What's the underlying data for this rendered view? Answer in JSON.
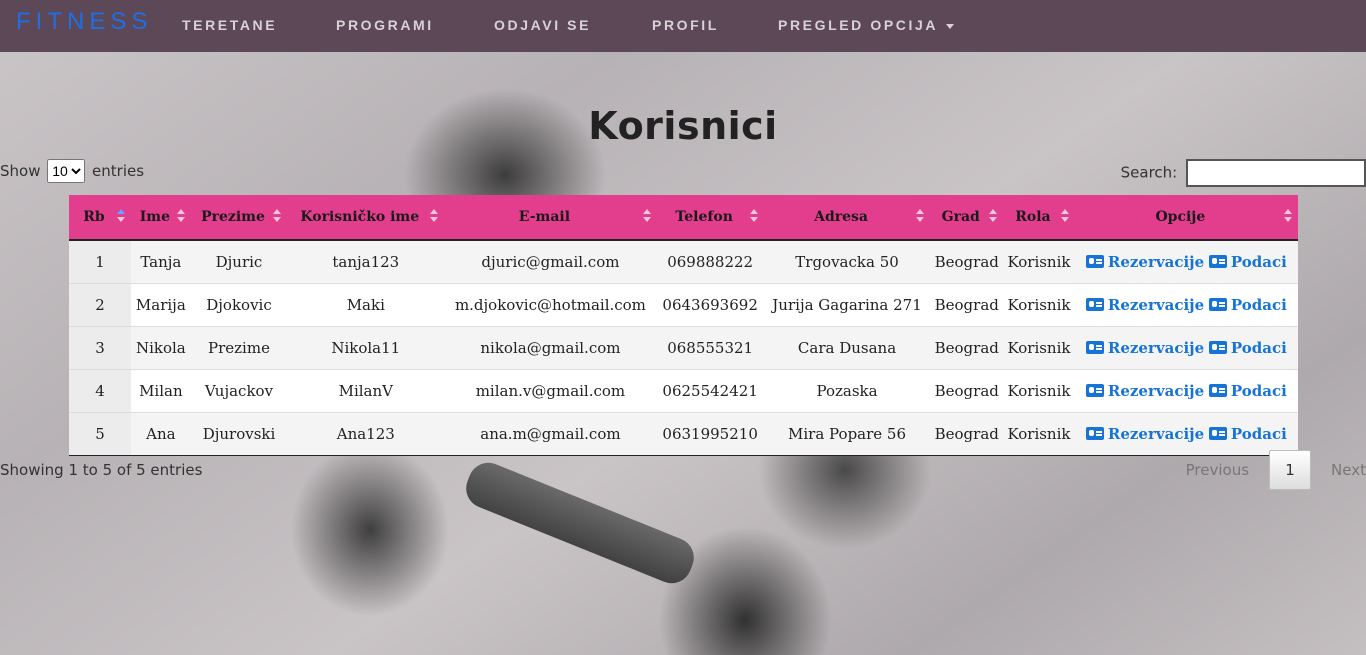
{
  "nav": {
    "brand": "FITNESS",
    "links": [
      "TERETANE",
      "PROGRAMI",
      "ODJAVI SE",
      "PROFIL",
      "PREGLED OPCIJA"
    ]
  },
  "page": {
    "title": "Korisnici"
  },
  "controls": {
    "show_label": "Show",
    "entries_label": "entries",
    "length_value": "10",
    "search_label": "Search:",
    "search_value": ""
  },
  "table": {
    "columns": [
      "Rb",
      "Ime",
      "Prezime",
      "Korisničko ime",
      "E-mail",
      "Telefon",
      "Adresa",
      "Grad",
      "Rola",
      "Opcije"
    ],
    "rows": [
      {
        "rb": "1",
        "ime": "Tanja",
        "prezime": "Djuric",
        "korisnicko": "tanja123",
        "email": "djuric@gmail.com",
        "telefon": "069888222",
        "adresa": "Trgovacka 50",
        "grad": "Beograd",
        "rola": "Korisnik"
      },
      {
        "rb": "2",
        "ime": "Marija",
        "prezime": "Djokovic",
        "korisnicko": "Maki",
        "email": "m.djokovic@hotmail.com",
        "telefon": "0643693692",
        "adresa": "Jurija Gagarina 271",
        "grad": "Beograd",
        "rola": "Korisnik"
      },
      {
        "rb": "3",
        "ime": "Nikola",
        "prezime": "Prezime",
        "korisnicko": "Nikola11",
        "email": "nikola@gmail.com",
        "telefon": "068555321",
        "adresa": "Cara Dusana",
        "grad": "Beograd",
        "rola": "Korisnik"
      },
      {
        "rb": "4",
        "ime": "Milan",
        "prezime": "Vujackov",
        "korisnicko": "MilanV",
        "email": "milan.v@gmail.com",
        "telefon": "0625542421",
        "adresa": "Pozaska",
        "grad": "Beograd",
        "rola": "Korisnik"
      },
      {
        "rb": "5",
        "ime": "Ana",
        "prezime": "Djurovski",
        "korisnicko": "Ana123",
        "email": "ana.m@gmail.com",
        "telefon": "0631995210",
        "adresa": "Mira Popare 56",
        "grad": "Beograd",
        "rola": "Korisnik"
      }
    ],
    "option_labels": {
      "reservations": "Rezervacije",
      "details": "Podaci"
    }
  },
  "footer": {
    "info": "Showing 1 to 5 of 5 entries",
    "previous": "Previous",
    "page": "1",
    "next": "Next"
  },
  "colors": {
    "navbar": "#5c4857",
    "brand": "#1e6fe6",
    "table_header": "#e33d8e",
    "link": "#1674d6"
  },
  "icons": [
    "id-card-icon",
    "sort-icon",
    "caret-down-icon"
  ]
}
